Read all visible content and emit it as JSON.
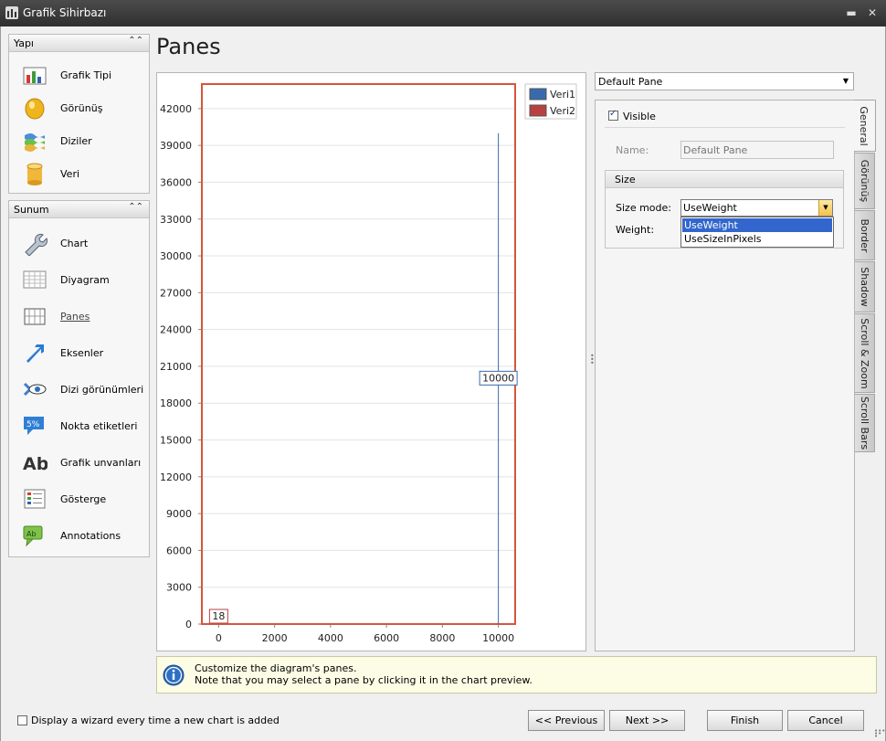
{
  "window": {
    "title": "Grafik Sihirbazı"
  },
  "page_title": "Panes",
  "nav": {
    "yapi": {
      "title": "Yapı",
      "items": [
        {
          "label": "Grafik Tipi",
          "icon": "chart-type-icon"
        },
        {
          "label": "Görünüş",
          "icon": "appearance-icon"
        },
        {
          "label": "Diziler",
          "icon": "series-icon"
        },
        {
          "label": "Veri",
          "icon": "data-icon"
        }
      ]
    },
    "sunum": {
      "title": "Sunum",
      "items": [
        {
          "label": "Chart",
          "icon": "wrench-icon"
        },
        {
          "label": "Diyagram",
          "icon": "diagram-icon"
        },
        {
          "label": "Panes",
          "icon": "panes-icon"
        },
        {
          "label": "Eksenler",
          "icon": "axes-arrow-icon"
        },
        {
          "label": "Dizi görünümleri",
          "icon": "series-view-icon"
        },
        {
          "label": "Nokta etiketleri",
          "icon": "point-labels-icon"
        },
        {
          "label": "Grafik unvanları",
          "icon": "chart-titles-icon"
        },
        {
          "label": "Gösterge",
          "icon": "legend-icon"
        },
        {
          "label": "Annotations",
          "icon": "annotations-icon"
        }
      ],
      "icon_texts": {
        "point_labels": "5%",
        "chart_titles": "Ab",
        "annotations": "Ab"
      }
    }
  },
  "chart_data": {
    "type": "bar",
    "x_ticks": [
      "0",
      "2000",
      "4000",
      "6000",
      "8000",
      "10000"
    ],
    "y_ticks": [
      "0",
      "3000",
      "6000",
      "9000",
      "12000",
      "15000",
      "18000",
      "21000",
      "24000",
      "27000",
      "30000",
      "33000",
      "36000",
      "39000",
      "42000"
    ],
    "xlim": [
      -600,
      10600
    ],
    "ylim": [
      0,
      44000
    ],
    "series": [
      {
        "name": "Veri1",
        "color": "#3a6aad",
        "points": [
          {
            "x": 10000,
            "y": 40000,
            "label": "10000"
          }
        ]
      },
      {
        "name": "Veri2",
        "color": "#b94040",
        "points": [
          {
            "x": 0,
            "y": 18,
            "label": "18"
          }
        ]
      }
    ],
    "legend": "top-right",
    "grid": true,
    "pane_border_color": "#d6553a"
  },
  "panel": {
    "pane_select": "Default Pane",
    "tabs": [
      "General",
      "Görünüş",
      "Border",
      "Shadow",
      "Scroll & Zoom",
      "Scroll Bars"
    ],
    "visible_label": "Visible",
    "visible_checked": true,
    "name_label": "Name:",
    "name_placeholder": "Default Pane",
    "size_group_title": "Size",
    "size_mode_label": "Size mode:",
    "size_mode_value": "UseWeight",
    "weight_label": "Weight:",
    "size_mode_options": [
      "UseWeight",
      "UseSizeInPixels"
    ]
  },
  "hint": {
    "line1": "Customize the diagram's panes.",
    "line2": "Note that you may select a pane by clicking it in the chart preview."
  },
  "footer": {
    "checkbox_label": "Display a wizard every time a new chart is added",
    "checkbox_checked": false,
    "previous": "<< Previous",
    "next": "Next >>",
    "finish": "Finish",
    "cancel": "Cancel"
  }
}
